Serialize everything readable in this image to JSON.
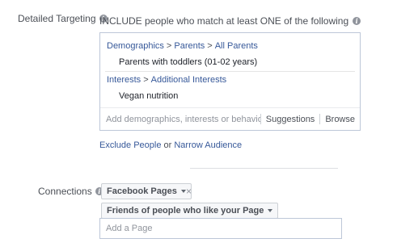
{
  "detailed_targeting": {
    "label": "Detailed Targeting",
    "include_text": "INCLUDE people who match at least ONE of the following",
    "groups": [
      {
        "breadcrumb": [
          "Demographics",
          "Parents",
          "All Parents"
        ],
        "item": "Parents with toddlers (01-02 years)"
      },
      {
        "breadcrumb": [
          "Interests",
          "Additional Interests"
        ],
        "item": "Vegan nutrition"
      }
    ],
    "separator": ">",
    "search_placeholder": "Add demographics, interests or behaviors",
    "suggestions_label": "Suggestions",
    "browse_label": "Browse",
    "exclude_people_label": "Exclude People",
    "or_text": "or",
    "narrow_audience_label": "Narrow Audience"
  },
  "connections": {
    "label": "Connections",
    "type_dropdown": "Facebook Pages",
    "close_symbol": "×",
    "sub_dropdown": "Friends of people who like your Page",
    "page_placeholder": "Add a Page"
  },
  "icons": {
    "info_glyph": "i"
  },
  "colors": {
    "link": "#365899",
    "label": "#4b4f56",
    "box_border": "#bdc7d8"
  }
}
